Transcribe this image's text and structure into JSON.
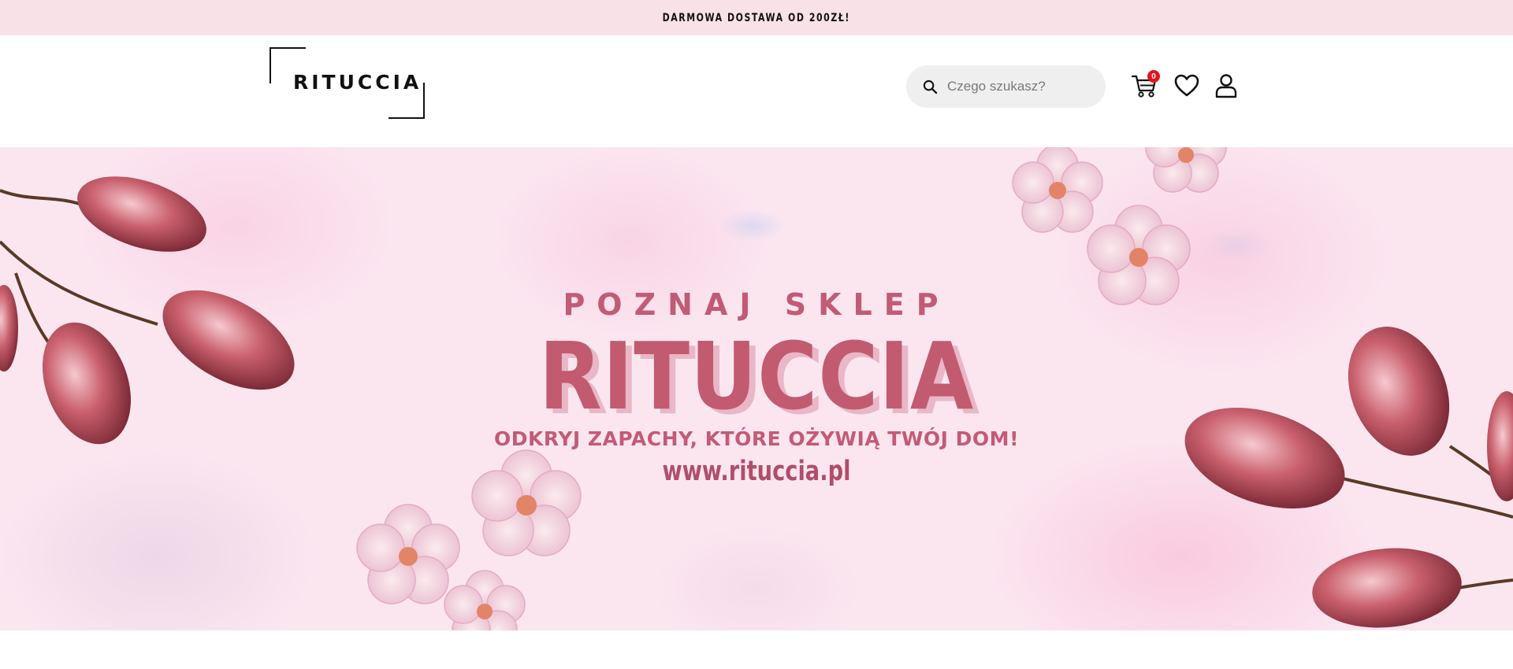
{
  "announcement": {
    "text": "DARMOWA DOSTAWA OD 200ZŁ!"
  },
  "header": {
    "logo_text": "RITUCCIA",
    "search": {
      "placeholder": "Czego szukasz?",
      "value": "",
      "icon": "search-icon"
    },
    "cart": {
      "icon": "cart-icon",
      "count": "0"
    },
    "wishlist": {
      "icon": "heart-icon"
    },
    "account": {
      "icon": "user-icon"
    }
  },
  "hero": {
    "kicker": "POZNAJ SKLEP",
    "title": "RITUCCIA",
    "tagline": "ODKRYJ ZAPACHY, KTÓRE OŻYWIĄ TWÓJ DOM!",
    "url": "www.rituccia.pl"
  },
  "colors": {
    "announcement_bg": "#f8e1e7",
    "hero_text": "#c25b70",
    "badge": "#e0141e",
    "search_bg": "#efefef"
  }
}
